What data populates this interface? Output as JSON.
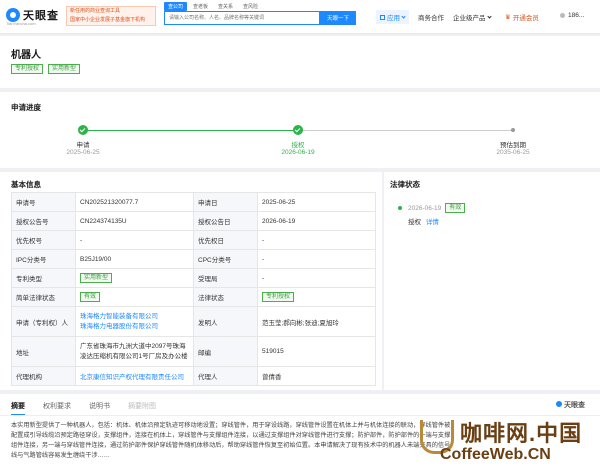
{
  "topbar": {
    "logo_text": "天眼查",
    "logo_sub": "TianYancha.com",
    "promo_line1": "新任用的商业查询工具",
    "promo_line2": "国家中小企业发展子基金旗下机构",
    "search_tabs": [
      "查公司",
      "查老板",
      "查关系",
      "查风险"
    ],
    "search_placeholder": "请输入公司名称、人名、品牌名称等关键词",
    "search_button": "天眼一下",
    "nav_app": "应用",
    "nav_partner": "商务合作",
    "nav_enterprise": "企业级产品",
    "nav_vip": "开通会员",
    "nav_user": "186..."
  },
  "header": {
    "title": "机器人",
    "tags": [
      "专利授权",
      "实用新型"
    ]
  },
  "progress": {
    "section_title": "申请进度",
    "steps": [
      {
        "label": "申请",
        "date": "2025-06-25",
        "state": "done"
      },
      {
        "label": "授权",
        "date": "2026-06-19",
        "state": "current"
      },
      {
        "label": "预估到期",
        "date": "2035-06-25",
        "state": "pending"
      }
    ]
  },
  "basic_info": {
    "section_title": "基本信息",
    "rows": [
      {
        "k1": "申请号",
        "v1": "CN202521320077.7",
        "k2": "申请日",
        "v2": "2025-06-25"
      },
      {
        "k1": "授权公告号",
        "v1": "CN224374135U",
        "k2": "授权公告日",
        "v2": "2026-06-19"
      },
      {
        "k1": "优先权号",
        "v1": "-",
        "k2": "优先权日",
        "v2": "-"
      },
      {
        "k1": "IPC分类号",
        "v1": "B25J19/00",
        "k2": "CPC分类号",
        "v2": "-"
      },
      {
        "k1": "专利类型",
        "v1": "实用新型",
        "k2": "受理局",
        "v2": "-"
      },
      {
        "k1": "简单法律状态",
        "v1": "有效",
        "k2": "法律状态",
        "v2": "专利授权"
      },
      {
        "k1": "申请（专利权）人",
        "v1a": "珠海格力智能装备有限公司",
        "v1b": "珠海格力电器股份有限公司",
        "k2": "发明人",
        "v2": "范玉莹;郝向彬;张迪;夏旭玲"
      },
      {
        "k1": "地址",
        "v1a": "广东省珠海市九洲大道中2097号珠海",
        "v1b": "凌达压缩机有限公司1号厂房及办公楼",
        "k2": "邮编",
        "v2": "519015"
      },
      {
        "k1": "代理机构",
        "v1": "北京康信知识产权代理有限责任公司",
        "k2": "代理人",
        "v2": "曾倩香"
      }
    ]
  },
  "legal_status": {
    "section_title": "法律状态",
    "date": "2026-06-19",
    "badge": "有效",
    "event": "授权",
    "detail_link": "详情"
  },
  "tabs": {
    "items": [
      "摘要",
      "权利要求",
      "说明书",
      "摘要附图"
    ],
    "brand": "天眼查",
    "summary_text": "本实用新型提供了一种机器人，包括：机体、机体沿预定轨迹可移动地设置；穿线管件，用于穿设线路，穿线管件设置在机体上并与机体连接的联动，穿线管件被配置成引导线缆沿预定路径穿设，支撑组件，连接在机体上，穿线管件与支撑组件连接，以通过支撑组件对穿线管件进行支撑；防护部件，防护部件的一端与支撑组件连接，另一端与穿线管件连接，通过防护部件保护穿线管件随机体移动后，帮助穿线管件恢复至初始位置。本申请解决了现有技术中的机器人未端夹具的信号线与气路管线容易发生缠绕干涉……"
  },
  "watermark": {
    "main": "咖啡网.中国",
    "sub": "CoffeeWeb.CN"
  }
}
